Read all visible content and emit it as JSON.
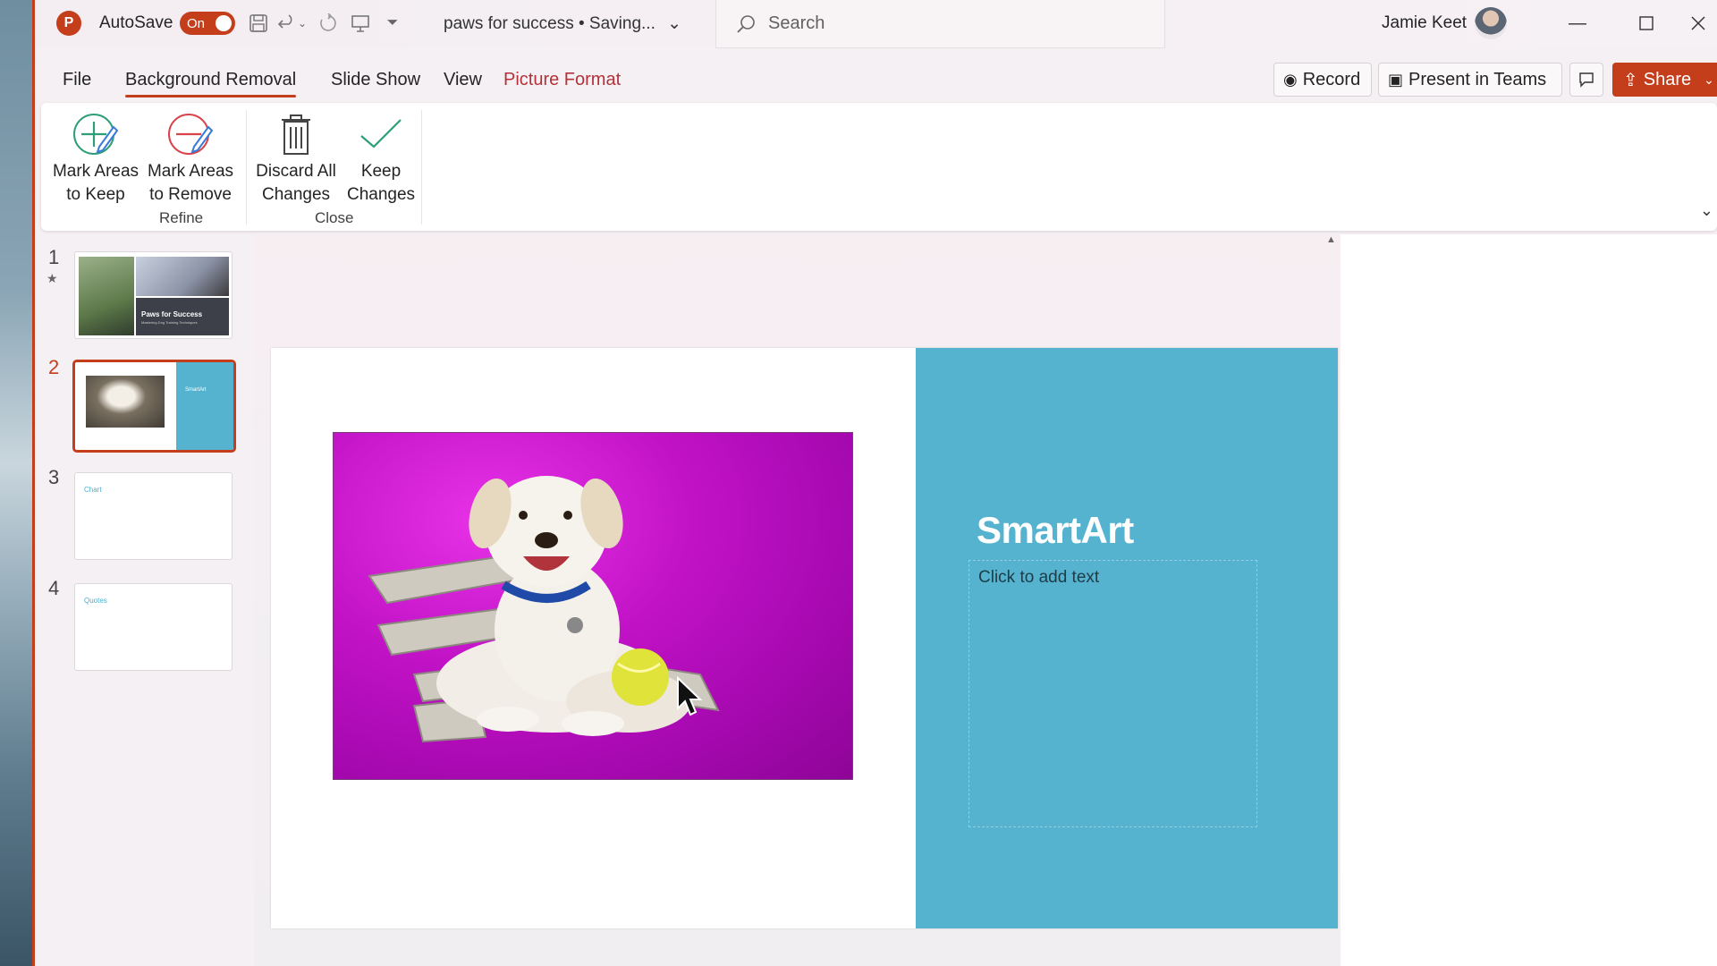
{
  "titlebar": {
    "autosave_label": "AutoSave",
    "autosave_state": "On",
    "document_title": "paws for success • Saving...",
    "search_placeholder": "Search",
    "user_name": "Jamie Keet"
  },
  "tabs": [
    {
      "label": "File"
    },
    {
      "label": "Background Removal",
      "active": true
    },
    {
      "label": "Slide Show"
    },
    {
      "label": "View"
    },
    {
      "label": "Picture Format",
      "accent": true
    }
  ],
  "actions": {
    "record": "Record",
    "present_in_teams": "Present in Teams",
    "share": "Share"
  },
  "ribbon": {
    "groups": [
      {
        "label": "Refine",
        "buttons": [
          {
            "line1": "Mark Areas",
            "line2": "to Keep",
            "icon": "mark-keep-icon"
          },
          {
            "line1": "Mark Areas",
            "line2": "to Remove",
            "icon": "mark-remove-icon"
          }
        ]
      },
      {
        "label": "Close",
        "buttons": [
          {
            "line1": "Discard All",
            "line2": "Changes",
            "icon": "trash-icon"
          },
          {
            "line1": "Keep",
            "line2": "Changes",
            "icon": "checkmark-icon"
          }
        ]
      }
    ]
  },
  "slides": [
    {
      "number": "1",
      "title": "Paws for Success",
      "subtitle": "Mastering Dog Training Techniques"
    },
    {
      "number": "2",
      "title": "SmartArt",
      "selected": true
    },
    {
      "number": "3",
      "title": "Chart"
    },
    {
      "number": "4",
      "title": "Quotes"
    }
  ],
  "current_slide": {
    "heading": "SmartArt",
    "body_placeholder": "Click to add text",
    "panel_color": "#56b3d0",
    "removal_overlay_color": "#c112c6"
  },
  "colors": {
    "accent": "#c43e1c",
    "picture_format_tab": "#b3323a"
  }
}
